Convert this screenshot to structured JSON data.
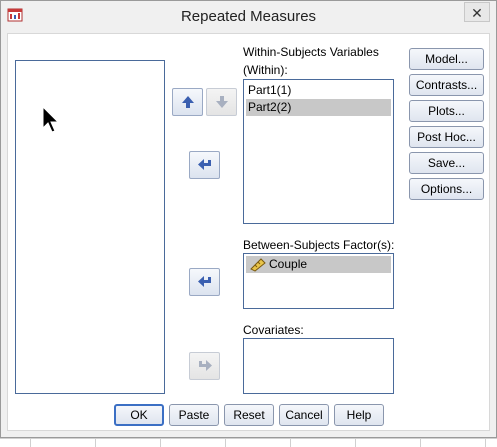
{
  "window": {
    "title": "Repeated Measures",
    "close_glyph": "✕"
  },
  "source_list": {
    "items": []
  },
  "within": {
    "label_line1": "Within-Subjects Variables",
    "label_line2": "(Within):",
    "items": [
      {
        "label": "Part1(1)",
        "selected": false
      },
      {
        "label": "Part2(2)",
        "selected": true
      }
    ]
  },
  "between": {
    "label": "Between-Subjects Factor(s):",
    "items": [
      {
        "label": "Couple",
        "icon": "ruler-nominal-icon",
        "selected": true
      }
    ]
  },
  "covariates": {
    "label": "Covariates:",
    "items": []
  },
  "side_buttons": [
    {
      "id": "model",
      "label": "Model..."
    },
    {
      "id": "contrasts",
      "label": "Contrasts..."
    },
    {
      "id": "plots",
      "label": "Plots..."
    },
    {
      "id": "post-hoc",
      "label": "Post Hoc..."
    },
    {
      "id": "save",
      "label": "Save..."
    },
    {
      "id": "options",
      "label": "Options..."
    }
  ],
  "bottom_buttons": [
    {
      "id": "ok",
      "label": "OK"
    },
    {
      "id": "paste",
      "label": "Paste"
    },
    {
      "id": "reset",
      "label": "Reset"
    },
    {
      "id": "cancel",
      "label": "Cancel"
    },
    {
      "id": "help",
      "label": "Help"
    }
  ],
  "colors": {
    "arrow_blue": "#3a5fb0",
    "arrow_disabled": "#a8b0c0",
    "selection_gray": "#c8c8c8",
    "list_border": "#4a6a9a"
  }
}
